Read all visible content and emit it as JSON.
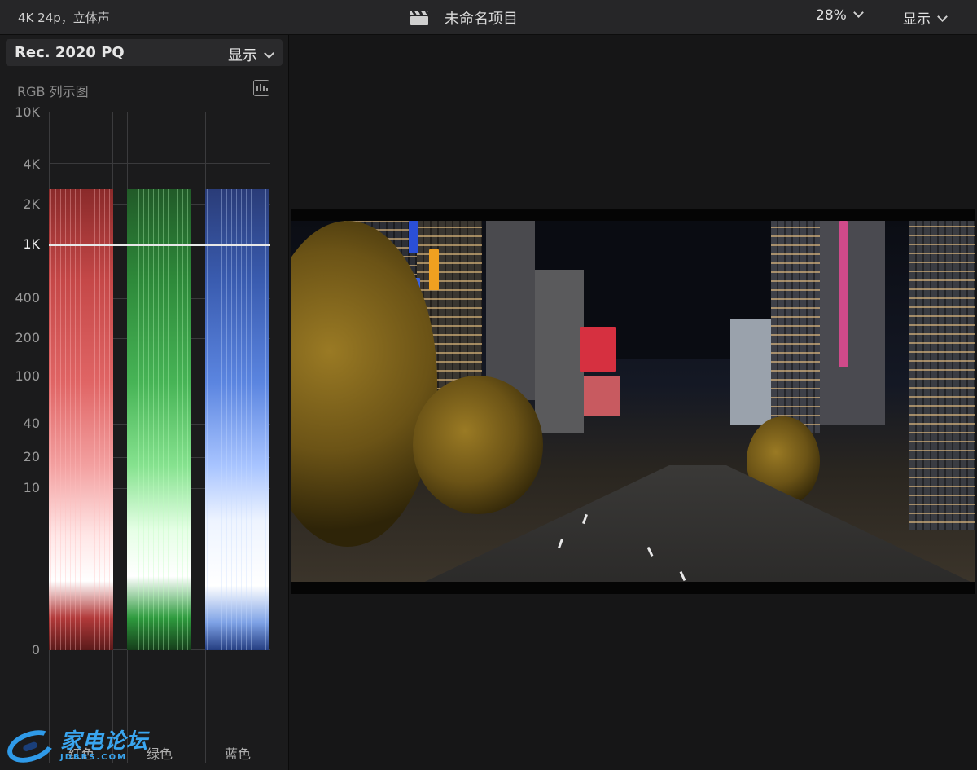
{
  "topbar": {
    "format_label": "4K 24p，立体声",
    "project_title": "未命名项目",
    "zoom_value": "28%",
    "view_label": "显示"
  },
  "scopes": {
    "color_space": "Rec. 2020 PQ",
    "display_label": "显示",
    "scope_type": "RGB 列示图",
    "y_ticks": [
      "10K",
      "4K",
      "2K",
      "1K",
      "400",
      "200",
      "100",
      "40",
      "20",
      "10",
      "0"
    ],
    "channels": [
      {
        "label": "红色",
        "color": "#e05a5a"
      },
      {
        "label": "绿色",
        "color": "#4cc45a"
      },
      {
        "label": "蓝色",
        "color": "#6f95ea"
      }
    ]
  },
  "watermark": {
    "cn": "家电论坛",
    "en": "JDBBS.COM"
  },
  "colors": {
    "panel_bg": "#1b1b1c",
    "topbar_bg": "#262628",
    "accent_watermark": "#3aa6f0"
  }
}
